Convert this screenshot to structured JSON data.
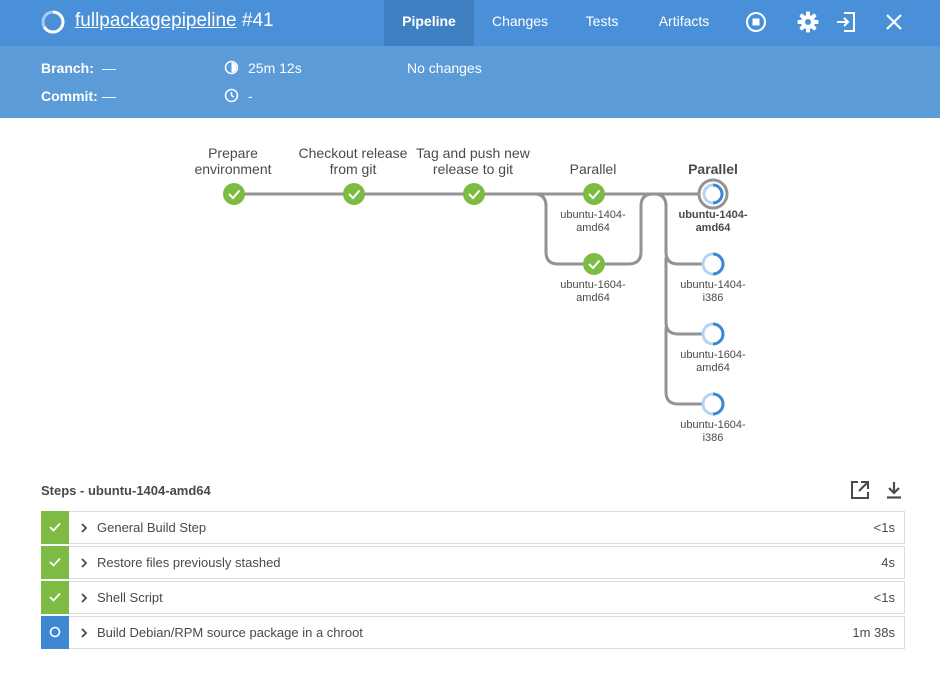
{
  "header": {
    "job_name": "fullpackagepipeline",
    "run_number": "#41",
    "tabs": [
      {
        "label": "Pipeline",
        "active": true
      },
      {
        "label": "Changes",
        "active": false
      },
      {
        "label": "Tests",
        "active": false
      },
      {
        "label": "Artifacts",
        "active": false
      }
    ],
    "icons": [
      "stop-icon",
      "gear-icon",
      "exit-icon",
      "close-icon"
    ]
  },
  "summary": {
    "branch_label": "Branch:",
    "branch_value": "—",
    "commit_label": "Commit:",
    "commit_value": "—",
    "duration": "25m 12s",
    "ended": "-",
    "changes": "No changes"
  },
  "pipeline": {
    "stages": [
      {
        "label_lines": [
          "Prepare",
          "environment"
        ],
        "status": "success"
      },
      {
        "label_lines": [
          "Checkout release",
          "from git"
        ],
        "status": "success"
      },
      {
        "label_lines": [
          "Tag and push new",
          "release to git"
        ],
        "status": "success"
      },
      {
        "label_lines": [
          "Parallel"
        ],
        "status": "success",
        "branches": [
          {
            "label_lines": [
              "ubuntu-1404-",
              "amd64"
            ],
            "status": "success"
          },
          {
            "label_lines": [
              "ubuntu-1604-",
              "amd64"
            ],
            "status": "success"
          }
        ]
      },
      {
        "label_lines": [
          "Parallel"
        ],
        "status": "running",
        "selected": true,
        "branches": [
          {
            "label_lines": [
              "ubuntu-1404-",
              "amd64"
            ],
            "status": "running",
            "selected": true
          },
          {
            "label_lines": [
              "ubuntu-1404-",
              "i386"
            ],
            "status": "running"
          },
          {
            "label_lines": [
              "ubuntu-1604-",
              "amd64"
            ],
            "status": "running"
          },
          {
            "label_lines": [
              "ubuntu-1604-",
              "i386"
            ],
            "status": "running"
          }
        ]
      }
    ]
  },
  "steps": {
    "title": "Steps - ubuntu-1404-amd64",
    "items": [
      {
        "name": "General Build Step",
        "duration": "<1s",
        "status": "success"
      },
      {
        "name": "Restore files previously stashed",
        "duration": "4s",
        "status": "success"
      },
      {
        "name": "Shell Script",
        "duration": "<1s",
        "status": "success"
      },
      {
        "name": "Build Debian/RPM source package in a chroot",
        "duration": "1m 38s",
        "status": "running"
      }
    ]
  },
  "colors": {
    "header": "#4a90d9",
    "subheader": "#5b9bd8",
    "success": "#7dbb42",
    "running": "#3d87d3",
    "connector": "#949393"
  }
}
